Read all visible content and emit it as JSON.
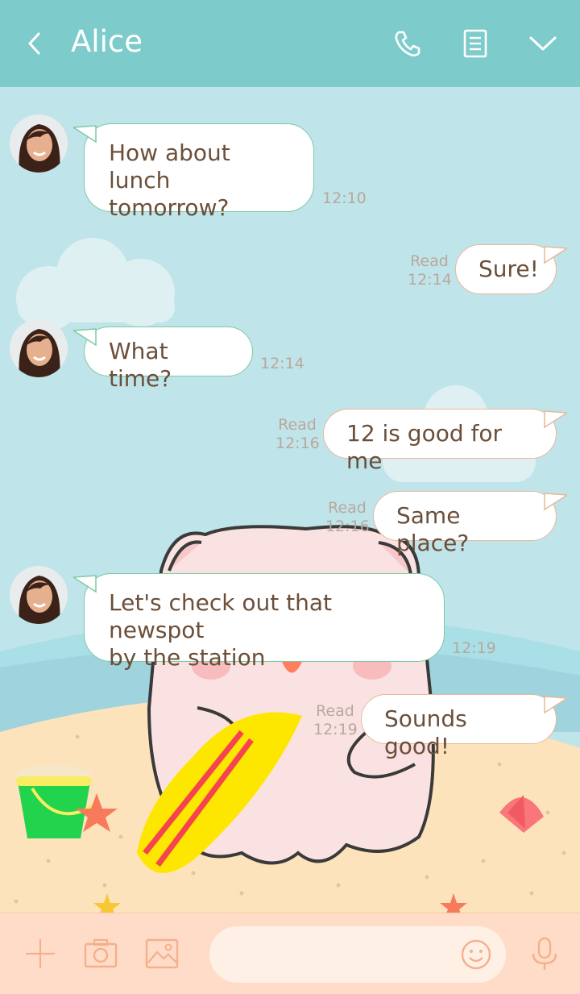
{
  "header": {
    "title": "Alice"
  },
  "messages": [
    {
      "side": "in",
      "text": "How about lunch\ntomorrow?",
      "time": "12:10"
    },
    {
      "side": "out",
      "text": "Sure!",
      "read": "Read",
      "time": "12:14"
    },
    {
      "side": "in",
      "text": "What time?",
      "time": "12:14"
    },
    {
      "side": "out",
      "text": "12 is good for me",
      "read": "Read",
      "time": "12:16"
    },
    {
      "side": "out",
      "text": "Same place?",
      "read": "Read",
      "time": "12:16"
    },
    {
      "side": "in",
      "text": "Let's check out that newspot\nby the station",
      "time": "12:19"
    },
    {
      "side": "out",
      "text": "Sounds good!",
      "read": "Read",
      "time": "12:19"
    }
  ],
  "colors": {
    "header": "#7ecbcb",
    "sky": "#bfe4ea",
    "sand": "#fde3bb",
    "bar": "#ffdcc8",
    "text": "#6b4f3a",
    "icon": "#f4b08c"
  }
}
